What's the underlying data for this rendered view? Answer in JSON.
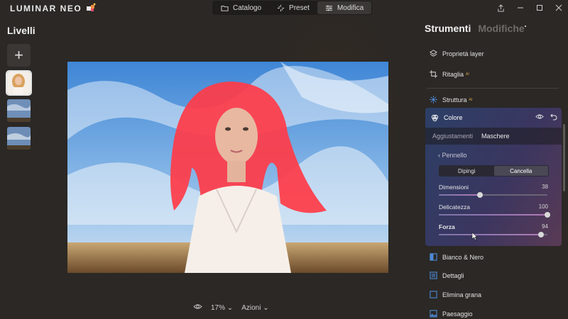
{
  "app": {
    "logo_text": "LUMINAR NEO"
  },
  "modes": [
    {
      "label": "Catalogo",
      "icon": "folder-icon"
    },
    {
      "label": "Preset",
      "icon": "sparkle-icon"
    },
    {
      "label": "Modifica",
      "icon": "sliders-icon"
    }
  ],
  "layers": {
    "title": "Livelli",
    "add_label": "+"
  },
  "canvas": {
    "zoom": "17%",
    "actions_label": "Azioni"
  },
  "right_panel": {
    "tab_tools": "Strumenti",
    "tab_edits": "Modifiche",
    "tab_edits_dot": "•",
    "tools_top": [
      {
        "label": "Proprietà layer",
        "ai": ""
      },
      {
        "label": "Ritaglia",
        "ai": "AI"
      },
      {
        "label": "Struttura",
        "ai": "AI"
      }
    ],
    "colore": {
      "label": "Colore",
      "subtab_adjust": "Aggiustamenti",
      "subtab_masks": "Maschere",
      "back_label": "‹  Pennello",
      "paint_label": "Dipingi",
      "erase_label": "Cancella",
      "sliders": [
        {
          "label": "Dimensioni",
          "value": 38,
          "max": 100
        },
        {
          "label": "Delicatezza",
          "value": 100,
          "max": 100
        },
        {
          "label": "Forza",
          "value": 94,
          "max": 100
        }
      ]
    },
    "tools_bottom": [
      {
        "label": "Bianco & Nero"
      },
      {
        "label": "Dettagli"
      },
      {
        "label": "Elimina grana"
      },
      {
        "label": "Paesaggio"
      }
    ]
  },
  "colors": {
    "accent": "#4d8ad6",
    "mask_red": "#ff3b48",
    "panel_bg": "#2b2825"
  }
}
